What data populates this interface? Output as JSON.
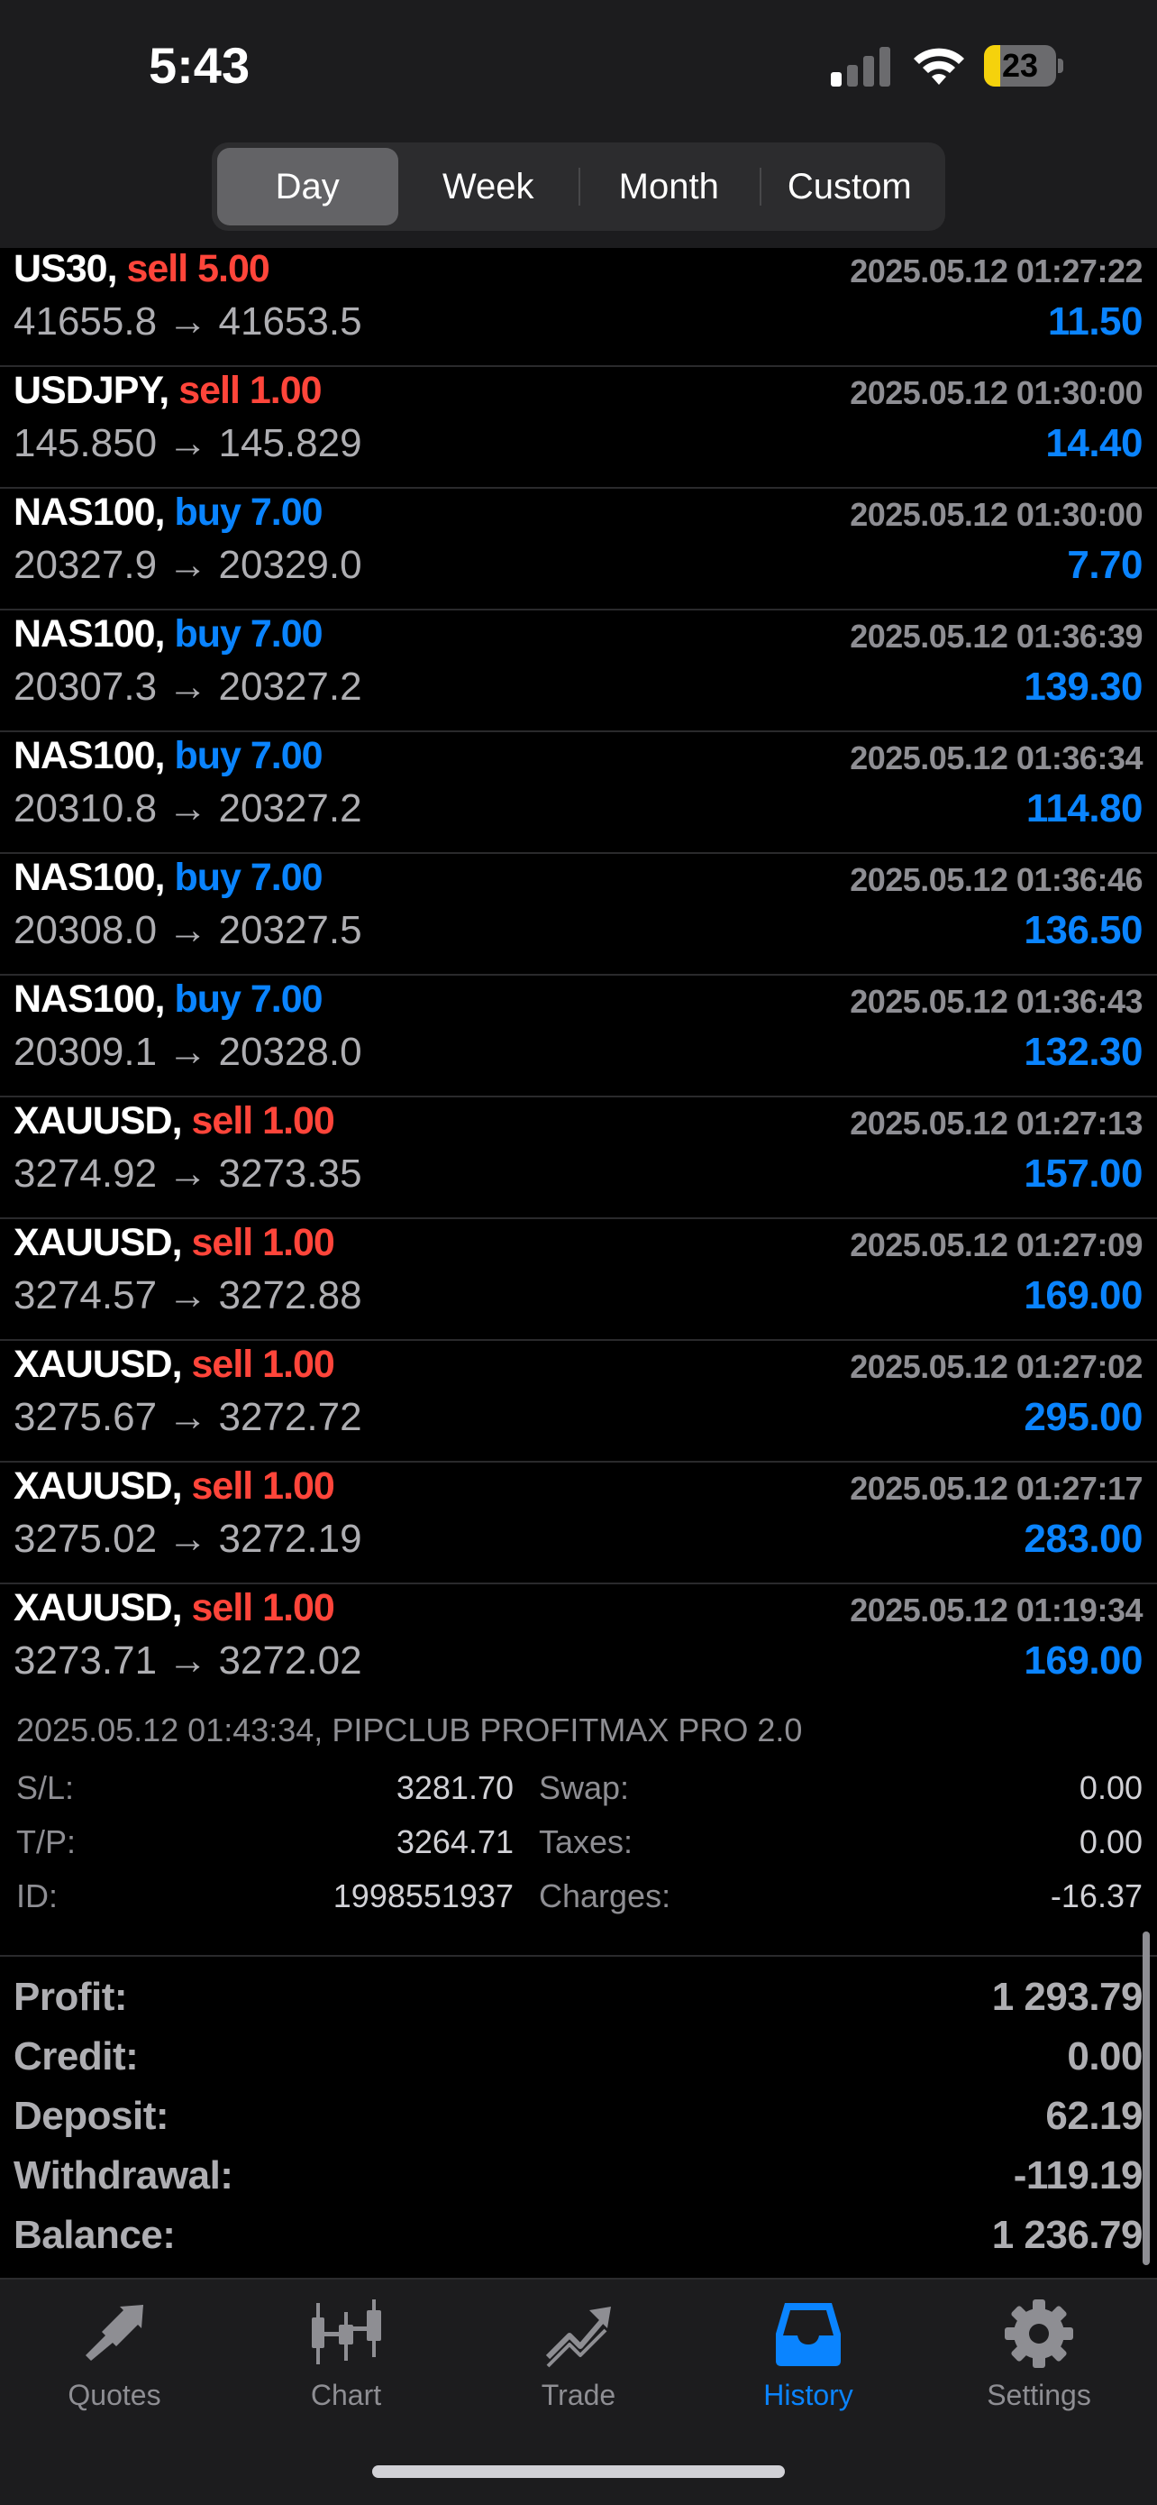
{
  "status_bar": {
    "time": "5:43",
    "battery": "23",
    "battery_level": 0.23
  },
  "period_tabs": [
    {
      "label": "Day",
      "active": true
    },
    {
      "label": "Week",
      "active": false
    },
    {
      "label": "Month",
      "active": false
    },
    {
      "label": "Custom",
      "active": false
    }
  ],
  "deals": [
    {
      "symbol": "US30,",
      "side": "sell",
      "volume": "sell 5.00",
      "time": "2025.05.12 01:27:22",
      "prices": "41655.8 → 41653.5",
      "profit": "11.50"
    },
    {
      "symbol": "USDJPY,",
      "side": "sell",
      "volume": "sell 1.00",
      "time": "2025.05.12 01:30:00",
      "prices": "145.850 → 145.829",
      "profit": "14.40"
    },
    {
      "symbol": "NAS100,",
      "side": "buy",
      "volume": "buy 7.00",
      "time": "2025.05.12 01:30:00",
      "prices": "20327.9 → 20329.0",
      "profit": "7.70"
    },
    {
      "symbol": "NAS100,",
      "side": "buy",
      "volume": "buy 7.00",
      "time": "2025.05.12 01:36:39",
      "prices": "20307.3 → 20327.2",
      "profit": "139.30"
    },
    {
      "symbol": "NAS100,",
      "side": "buy",
      "volume": "buy 7.00",
      "time": "2025.05.12 01:36:34",
      "prices": "20310.8 → 20327.2",
      "profit": "114.80"
    },
    {
      "symbol": "NAS100,",
      "side": "buy",
      "volume": "buy 7.00",
      "time": "2025.05.12 01:36:46",
      "prices": "20308.0 → 20327.5",
      "profit": "136.50"
    },
    {
      "symbol": "NAS100,",
      "side": "buy",
      "volume": "buy 7.00",
      "time": "2025.05.12 01:36:43",
      "prices": "20309.1 → 20328.0",
      "profit": "132.30"
    },
    {
      "symbol": "XAUUSD,",
      "side": "sell",
      "volume": "sell 1.00",
      "time": "2025.05.12 01:27:13",
      "prices": "3274.92 → 3273.35",
      "profit": "157.00"
    },
    {
      "symbol": "XAUUSD,",
      "side": "sell",
      "volume": "sell 1.00",
      "time": "2025.05.12 01:27:09",
      "prices": "3274.57 → 3272.88",
      "profit": "169.00"
    },
    {
      "symbol": "XAUUSD,",
      "side": "sell",
      "volume": "sell 1.00",
      "time": "2025.05.12 01:27:02",
      "prices": "3275.67 → 3272.72",
      "profit": "295.00"
    },
    {
      "symbol": "XAUUSD,",
      "side": "sell",
      "volume": "sell 1.00",
      "time": "2025.05.12 01:27:17",
      "prices": "3275.02 → 3272.19",
      "profit": "283.00"
    },
    {
      "symbol": "XAUUSD,",
      "side": "sell",
      "volume": "sell 1.00",
      "time": "2025.05.12 01:19:34",
      "prices": "3273.71 → 3272.02",
      "profit": "169.00"
    }
  ],
  "details": {
    "comment": "2025.05.12 01:43:34, PIPCLUB PROFITMAX PRO 2.0",
    "sl_label": "S/L:",
    "sl_value": "3281.70",
    "tp_label": "T/P:",
    "tp_value": "3264.71",
    "id_label": "ID:",
    "id_value": "1998551937",
    "swap_label": "Swap:",
    "swap_value": "0.00",
    "taxes_label": "Taxes:",
    "taxes_value": "0.00",
    "charges_label": "Charges:",
    "charges_value": "-16.37"
  },
  "summary": [
    {
      "label": "Profit:",
      "value": "1 293.79"
    },
    {
      "label": "Credit:",
      "value": "0.00"
    },
    {
      "label": "Deposit:",
      "value": "62.19"
    },
    {
      "label": "Withdrawal:",
      "value": "-119.19"
    },
    {
      "label": "Balance:",
      "value": "1 236.79"
    }
  ],
  "tabbar": [
    {
      "label": "Quotes",
      "icon": "quotes-icon",
      "active": false
    },
    {
      "label": "Chart",
      "icon": "candlestick-chart-icon",
      "active": false
    },
    {
      "label": "Trade",
      "icon": "trade-trend-icon",
      "active": false
    },
    {
      "label": "History",
      "icon": "history-inbox-icon",
      "active": true
    },
    {
      "label": "Settings",
      "icon": "gear-icon",
      "active": false
    }
  ],
  "colors": {
    "sell": "#ff453a",
    "buy": "#0a84ff",
    "accent": "#0a84ff",
    "battery": "#f5d20c"
  }
}
